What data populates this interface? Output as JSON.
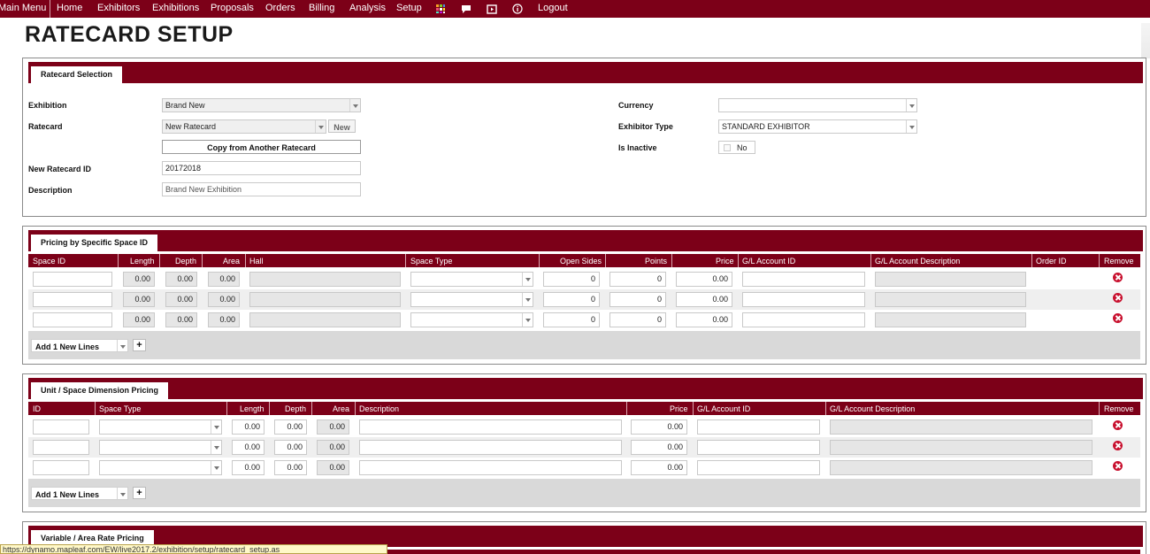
{
  "nav": {
    "items": [
      "Main Menu",
      "Home",
      "Exhibitors",
      "Exhibitions",
      "Proposals",
      "Orders",
      "Billing",
      "Analysis",
      "Setup"
    ],
    "icons": [
      "grid-icon",
      "chat-icon",
      "video-icon",
      "info-icon"
    ],
    "logout": "Logout"
  },
  "page_title": "RATECARD SETUP",
  "selection": {
    "tab": "Ratecard Selection",
    "exhibition_label": "Exhibition",
    "exhibition_value": "Brand New",
    "ratecard_label": "Ratecard",
    "ratecard_value": "New Ratecard",
    "new_button": "New",
    "copy_button": "Copy from Another Ratecard",
    "new_id_label": "New Ratecard ID",
    "new_id_value": "20172018",
    "description_label": "Description",
    "description_value": "Brand New Exhibition",
    "currency_label": "Currency",
    "currency_value": "",
    "exhibitor_type_label": "Exhibitor Type",
    "exhibitor_type_value": "STANDARD EXHIBITOR",
    "inactive_label": "Is Inactive",
    "inactive_value": "No"
  },
  "space_pricing": {
    "tab": "Pricing by Specific Space ID",
    "headers": [
      "Space ID",
      "Length",
      "Depth",
      "Area",
      "Hall",
      "Space Type",
      "Open Sides",
      "Points",
      "Price",
      "G/L Account ID",
      "G/L Account Description",
      "Order ID",
      "Remove"
    ],
    "rows": [
      {
        "space_id": "",
        "length": "0.00",
        "depth": "0.00",
        "area": "0.00",
        "hall": "",
        "space_type": "",
        "open_sides": "0",
        "points": "0",
        "price": "0.00",
        "gl_id": "",
        "gl_desc": "",
        "order_id": ""
      },
      {
        "space_id": "",
        "length": "0.00",
        "depth": "0.00",
        "area": "0.00",
        "hall": "",
        "space_type": "",
        "open_sides": "0",
        "points": "0",
        "price": "0.00",
        "gl_id": "",
        "gl_desc": "",
        "order_id": ""
      },
      {
        "space_id": "",
        "length": "0.00",
        "depth": "0.00",
        "area": "0.00",
        "hall": "",
        "space_type": "",
        "open_sides": "0",
        "points": "0",
        "price": "0.00",
        "gl_id": "",
        "gl_desc": "",
        "order_id": ""
      }
    ],
    "add_lines": "Add 1 New Lines",
    "plus": "+"
  },
  "unit_pricing": {
    "tab": "Unit / Space Dimension Pricing",
    "headers": [
      "ID",
      "Space Type",
      "Length",
      "Depth",
      "Area",
      "Description",
      "Price",
      "G/L Account ID",
      "G/L Account Description",
      "Remove"
    ],
    "rows": [
      {
        "id": "",
        "space_type": "",
        "length": "0.00",
        "depth": "0.00",
        "area": "0.00",
        "description": "",
        "price": "0.00",
        "gl_id": "",
        "gl_desc": ""
      },
      {
        "id": "",
        "space_type": "",
        "length": "0.00",
        "depth": "0.00",
        "area": "0.00",
        "description": "",
        "price": "0.00",
        "gl_id": "",
        "gl_desc": ""
      },
      {
        "id": "",
        "space_type": "",
        "length": "0.00",
        "depth": "0.00",
        "area": "0.00",
        "description": "",
        "price": "0.00",
        "gl_id": "",
        "gl_desc": ""
      }
    ],
    "add_lines": "Add 1 New Lines",
    "plus": "+"
  },
  "variable_pricing": {
    "tab": "Variable / Area Rate Pricing"
  },
  "status_url": "https://dynamo.mapleaf.com/EW/live2017.2/exhibition/setup/ratecard_setup.as",
  "colors": {
    "brand": "#7c0018",
    "remove": "#c8102e"
  }
}
